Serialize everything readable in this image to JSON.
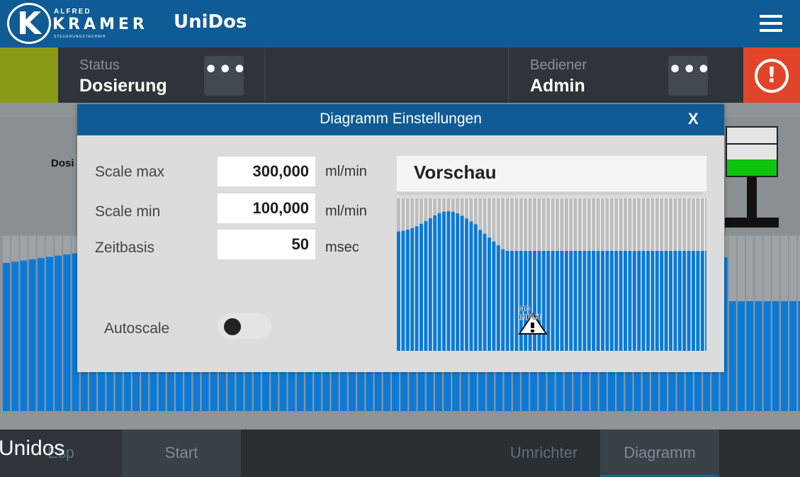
{
  "header": {
    "logo_letter": "K",
    "logo_small": "ALFRED",
    "logo_main": "KRAMER",
    "logo_sub": "STEUERUNGSTECHNIK",
    "app_title": "UniDos",
    "menu_icon": "hamburger-menu-icon"
  },
  "status_bar": {
    "status_label": "Status",
    "status_value": "Dosierung",
    "status_color": "#8a9a16",
    "more_label": "•••",
    "operator_label": "Bediener",
    "operator_value": "Admin",
    "alarm_icon": "alert-circle-icon",
    "alarm_glyph": "!",
    "alarm_color": "#e0452a"
  },
  "background": {
    "section_label": "Dosi"
  },
  "modal": {
    "title": "Diagramm Einstellungen",
    "close_label": "X",
    "fields": [
      {
        "label": "Scale max",
        "value": "300,000",
        "unit": "ml/min"
      },
      {
        "label": "Scale min",
        "value": "100,000",
        "unit": "ml/min"
      },
      {
        "label": "Zeitbasis",
        "value": "50",
        "unit": "msec"
      }
    ],
    "autoscale": {
      "label": "Autoscale",
      "on": false
    },
    "preview": {
      "title": "Vorschau",
      "overlay_line1": "NO",
      "overlay_line2": "INPUT",
      "overlay_icon": "no-input-warning-icon"
    }
  },
  "tabs": [
    {
      "label": "Esp"
    },
    {
      "label": "Start"
    },
    {
      "label": "Umrichter"
    },
    {
      "label": "Diagramm",
      "active": true
    }
  ],
  "overlay_caption": "Unidos",
  "colors": {
    "brand_blue": "#0f5b95",
    "bar_blue": "#0b7ad6",
    "bar_gray": "#bdbdbd",
    "gauge_green": "#0ec40e"
  }
}
